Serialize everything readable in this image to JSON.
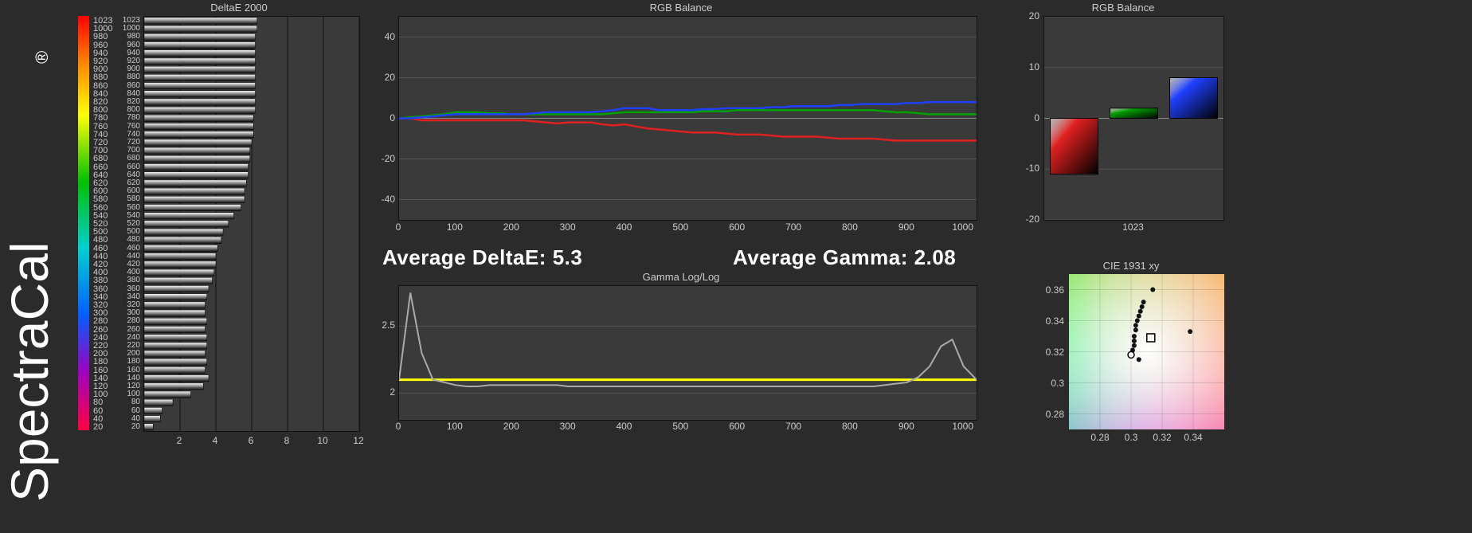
{
  "brand": "SpectraCal",
  "stats": {
    "avg_deltaE_label": "Average DeltaE:",
    "avg_deltaE_value": "5.3",
    "avg_gamma_label": "Average Gamma:",
    "avg_gamma_value": "2.08"
  },
  "chart_data": [
    {
      "id": "deltaE2000",
      "type": "bar",
      "orientation": "horizontal",
      "title": "DeltaE 2000",
      "xlabel": "",
      "ylabel": "",
      "xlim": [
        0,
        12
      ],
      "xticks": [
        2,
        4,
        6,
        8,
        10,
        12
      ],
      "ylim": [
        0,
        1023
      ],
      "yticks": [
        20,
        40,
        60,
        80,
        100,
        120,
        140,
        160,
        180,
        200,
        220,
        240,
        260,
        280,
        300,
        320,
        340,
        360,
        380,
        400,
        420,
        440,
        460,
        480,
        500,
        520,
        540,
        560,
        580,
        600,
        620,
        640,
        660,
        680,
        700,
        720,
        740,
        760,
        780,
        800,
        820,
        840,
        860,
        880,
        900,
        920,
        940,
        960,
        980,
        1000,
        1023
      ],
      "categories": [
        20,
        40,
        60,
        80,
        100,
        120,
        140,
        160,
        180,
        200,
        220,
        240,
        260,
        280,
        300,
        320,
        340,
        360,
        380,
        400,
        420,
        440,
        460,
        480,
        500,
        520,
        540,
        560,
        580,
        600,
        620,
        640,
        660,
        680,
        700,
        720,
        740,
        760,
        780,
        800,
        820,
        840,
        860,
        880,
        900,
        920,
        940,
        960,
        980,
        1000,
        1023
      ],
      "values": [
        0.5,
        0.9,
        1.0,
        1.6,
        2.6,
        3.3,
        3.6,
        3.4,
        3.5,
        3.4,
        3.5,
        3.5,
        3.4,
        3.5,
        3.4,
        3.4,
        3.5,
        3.6,
        3.8,
        3.9,
        4.0,
        4.0,
        4.1,
        4.3,
        4.4,
        4.7,
        5.0,
        5.4,
        5.6,
        5.6,
        5.7,
        5.8,
        5.8,
        5.9,
        5.9,
        6.0,
        6.1,
        6.1,
        6.1,
        6.2,
        6.2,
        6.2,
        6.2,
        6.2,
        6.2,
        6.2,
        6.2,
        6.2,
        6.2,
        6.3,
        6.3
      ]
    },
    {
      "id": "rgbBalanceLine",
      "type": "line",
      "title": "RGB Balance",
      "xlabel": "",
      "ylabel": "",
      "xlim": [
        0,
        1023
      ],
      "xticks": [
        0,
        100,
        200,
        300,
        400,
        500,
        600,
        700,
        800,
        900,
        1000
      ],
      "ylim": [
        -50,
        50
      ],
      "yticks": [
        -40,
        -20,
        0,
        20,
        40
      ],
      "x": [
        0,
        20,
        40,
        60,
        80,
        100,
        120,
        140,
        160,
        180,
        200,
        220,
        240,
        260,
        280,
        300,
        320,
        340,
        360,
        380,
        400,
        420,
        440,
        460,
        480,
        500,
        520,
        540,
        560,
        580,
        600,
        620,
        640,
        660,
        680,
        700,
        720,
        740,
        760,
        780,
        800,
        820,
        840,
        860,
        880,
        900,
        920,
        940,
        960,
        980,
        1000,
        1023
      ],
      "series": [
        {
          "name": "Red",
          "color": "#e02020",
          "values": [
            0,
            0,
            -1,
            -1,
            -1,
            -1,
            -1,
            -1,
            -1,
            -1,
            -1,
            -1,
            -1.5,
            -2,
            -2.5,
            -2,
            -2,
            -2,
            -3,
            -3.5,
            -3,
            -4,
            -5,
            -5.5,
            -6,
            -6.5,
            -7,
            -7,
            -7,
            -7.5,
            -8,
            -8,
            -8,
            -8.5,
            -9,
            -9,
            -9,
            -9,
            -9.5,
            -10,
            -10,
            -10,
            -10,
            -10.5,
            -11,
            -11,
            -11,
            -11,
            -11,
            -11,
            -11,
            -11
          ]
        },
        {
          "name": "Green",
          "color": "#00a000",
          "values": [
            0,
            0.5,
            1,
            1.5,
            2,
            3,
            3,
            3,
            2.5,
            2.5,
            2,
            2,
            2,
            2,
            2,
            2,
            2,
            2,
            2,
            2.5,
            3,
            3,
            3,
            3,
            3,
            3,
            3,
            3.5,
            3.5,
            3.5,
            4,
            4,
            4,
            4,
            4,
            4,
            4,
            4,
            4,
            4,
            4,
            4,
            4,
            3.5,
            3,
            3,
            2.5,
            2,
            2,
            2,
            2,
            2
          ]
        },
        {
          "name": "Blue",
          "color": "#2040ff",
          "values": [
            0,
            0,
            0.5,
            1,
            1.5,
            2,
            2,
            2,
            2,
            2,
            2,
            2,
            2.5,
            3,
            3,
            3,
            3,
            3,
            3.5,
            4,
            5,
            5,
            5,
            4,
            4,
            4,
            4,
            4.5,
            4.5,
            5,
            5,
            5,
            5,
            5.5,
            5.5,
            6,
            6,
            6,
            6,
            6.5,
            6.5,
            7,
            7,
            7,
            7,
            7.5,
            7.5,
            8,
            8,
            8,
            8,
            8
          ]
        }
      ]
    },
    {
      "id": "rgbBalanceBar",
      "type": "bar",
      "title": "RGB Balance",
      "xlabel": "1023",
      "ylabel": "",
      "xlim": [
        0,
        3
      ],
      "ylim": [
        -20,
        20
      ],
      "yticks": [
        -20,
        -10,
        0,
        10,
        20
      ],
      "categories": [
        "R",
        "G",
        "B"
      ],
      "series": [
        {
          "name": "1023",
          "values": [
            -11,
            2,
            8
          ],
          "colors": [
            "#e02020",
            "#00a000",
            "#2040ff"
          ]
        }
      ]
    },
    {
      "id": "gammaLogLog",
      "type": "line",
      "title": "Gamma Log/Log",
      "xlabel": "",
      "ylabel": "",
      "xlim": [
        0,
        1023
      ],
      "xticks": [
        0,
        100,
        200,
        300,
        400,
        500,
        600,
        700,
        800,
        900,
        1000
      ],
      "ylim": [
        1.8,
        2.8
      ],
      "yticks": [
        2,
        2.5
      ],
      "x": [
        0,
        20,
        40,
        60,
        80,
        100,
        120,
        140,
        160,
        180,
        200,
        220,
        240,
        260,
        280,
        300,
        320,
        340,
        360,
        380,
        400,
        420,
        440,
        460,
        480,
        500,
        520,
        540,
        560,
        580,
        600,
        620,
        640,
        660,
        680,
        700,
        720,
        740,
        760,
        780,
        800,
        820,
        840,
        860,
        880,
        900,
        920,
        940,
        960,
        980,
        1000,
        1023
      ],
      "series": [
        {
          "name": "target",
          "color": "#ffff00",
          "values": [
            2.1,
            2.1,
            2.1,
            2.1,
            2.1,
            2.1,
            2.1,
            2.1,
            2.1,
            2.1,
            2.1,
            2.1,
            2.1,
            2.1,
            2.1,
            2.1,
            2.1,
            2.1,
            2.1,
            2.1,
            2.1,
            2.1,
            2.1,
            2.1,
            2.1,
            2.1,
            2.1,
            2.1,
            2.1,
            2.1,
            2.1,
            2.1,
            2.1,
            2.1,
            2.1,
            2.1,
            2.1,
            2.1,
            2.1,
            2.1,
            2.1,
            2.1,
            2.1,
            2.1,
            2.1,
            2.1,
            2.1,
            2.1,
            2.1,
            2.1,
            2.1,
            2.1
          ]
        },
        {
          "name": "measured",
          "color": "#aaaaaa",
          "values": [
            2.1,
            2.75,
            2.3,
            2.1,
            2.08,
            2.06,
            2.05,
            2.05,
            2.06,
            2.06,
            2.06,
            2.06,
            2.06,
            2.06,
            2.06,
            2.05,
            2.05,
            2.05,
            2.05,
            2.05,
            2.05,
            2.05,
            2.05,
            2.05,
            2.05,
            2.05,
            2.05,
            2.05,
            2.05,
            2.05,
            2.05,
            2.05,
            2.05,
            2.05,
            2.05,
            2.05,
            2.05,
            2.05,
            2.05,
            2.05,
            2.05,
            2.05,
            2.05,
            2.06,
            2.07,
            2.08,
            2.12,
            2.2,
            2.35,
            2.4,
            2.2,
            2.1
          ]
        }
      ]
    },
    {
      "id": "cie1931",
      "type": "scatter",
      "title": "CIE 1931 xy",
      "xlabel": "",
      "ylabel": "",
      "xlim": [
        0.26,
        0.36
      ],
      "xticks": [
        0.28,
        0.3,
        0.32,
        0.34
      ],
      "ylim": [
        0.27,
        0.37
      ],
      "yticks": [
        0.28,
        0.3,
        0.32,
        0.34,
        0.36
      ],
      "target": {
        "x": 0.3127,
        "y": 0.329
      },
      "points": [
        {
          "x": 0.3,
          "y": 0.318
        },
        {
          "x": 0.301,
          "y": 0.321
        },
        {
          "x": 0.302,
          "y": 0.324
        },
        {
          "x": 0.302,
          "y": 0.327
        },
        {
          "x": 0.302,
          "y": 0.33
        },
        {
          "x": 0.303,
          "y": 0.334
        },
        {
          "x": 0.303,
          "y": 0.337
        },
        {
          "x": 0.304,
          "y": 0.34
        },
        {
          "x": 0.305,
          "y": 0.343
        },
        {
          "x": 0.306,
          "y": 0.346
        },
        {
          "x": 0.307,
          "y": 0.349
        },
        {
          "x": 0.308,
          "y": 0.352
        },
        {
          "x": 0.305,
          "y": 0.315
        },
        {
          "x": 0.314,
          "y": 0.36
        },
        {
          "x": 0.338,
          "y": 0.333
        }
      ]
    }
  ]
}
